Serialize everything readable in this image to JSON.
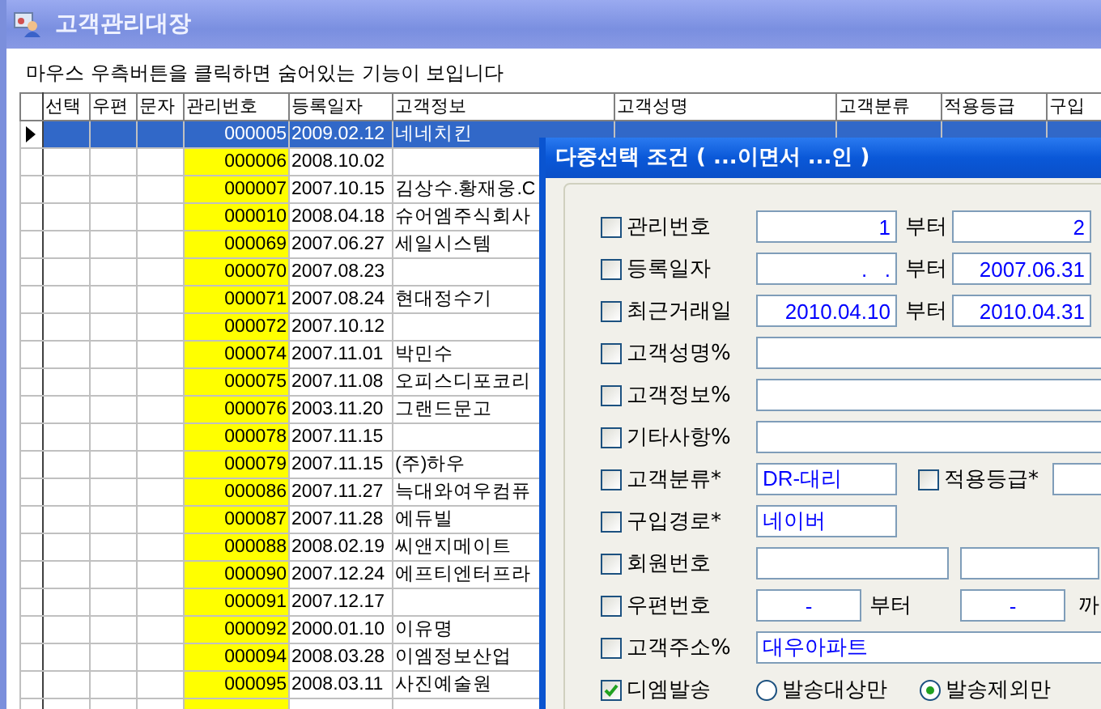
{
  "window": {
    "title": "고객관리대장"
  },
  "instruction": "마우스 우측버튼을 클릭하면 숨어있는 기능이 보입니다",
  "table": {
    "columns": [
      "선택",
      "우편",
      "문자",
      "관리번호",
      "등록일자",
      "고객정보",
      "고객성명",
      "고객분류",
      "적용등급",
      "구입"
    ],
    "rows": [
      {
        "selected": true,
        "id": "000005",
        "date": "2009.02.12",
        "info": "네네치킨"
      },
      {
        "selected": false,
        "id": "000006",
        "date": "2008.10.02"
      },
      {
        "selected": false,
        "id": "000007",
        "date": "2007.10.15",
        "info": "김상수.황재웅.C"
      },
      {
        "selected": false,
        "id": "000010",
        "date": "2008.04.18",
        "info": "슈어엠주식회사"
      },
      {
        "selected": false,
        "id": "000069",
        "date": "2007.06.27",
        "info": "세일시스템"
      },
      {
        "selected": false,
        "id": "000070",
        "date": "2007.08.23"
      },
      {
        "selected": false,
        "id": "000071",
        "date": "2007.08.24",
        "info": "현대정수기"
      },
      {
        "selected": false,
        "id": "000072",
        "date": "2007.10.12"
      },
      {
        "selected": false,
        "id": "000074",
        "date": "2007.11.01",
        "info": "박민수"
      },
      {
        "selected": false,
        "id": "000075",
        "date": "2007.11.08",
        "info": "오피스디포코리"
      },
      {
        "selected": false,
        "id": "000076",
        "date": "2003.11.20",
        "info": "그랜드문고"
      },
      {
        "selected": false,
        "id": "000078",
        "date": "2007.11.15"
      },
      {
        "selected": false,
        "id": "000079",
        "date": "2007.11.15",
        "info": "(주)하우"
      },
      {
        "selected": false,
        "id": "000086",
        "date": "2007.11.27",
        "info": "늑대와여우컴퓨"
      },
      {
        "selected": false,
        "id": "000087",
        "date": "2007.11.28",
        "info": "에듀빌"
      },
      {
        "selected": false,
        "id": "000088",
        "date": "2008.02.19",
        "info": "씨앤지메이트"
      },
      {
        "selected": false,
        "id": "000090",
        "date": "2007.12.24",
        "info": "에프티엔터프라"
      },
      {
        "selected": false,
        "id": "000091",
        "date": "2007.12.17"
      },
      {
        "selected": false,
        "id": "000092",
        "date": "2000.01.10",
        "info": "이유명"
      },
      {
        "selected": false,
        "id": "000094",
        "date": "2008.03.28",
        "info": "이엠정보산업"
      },
      {
        "selected": false,
        "id": "000095",
        "date": "2008.03.11",
        "info": "사진예술원"
      },
      {
        "selected": false
      }
    ]
  },
  "dialog": {
    "title": "다중선택 조건 ( ...이면서 ...인 )",
    "rows": [
      {
        "kind": "range",
        "checked": false,
        "label": "관리번호",
        "from": "1",
        "sep": "부터",
        "to": "2"
      },
      {
        "kind": "range",
        "checked": false,
        "label": "등록일자",
        "from": ".   .",
        "sep": "부터",
        "to": "2007.06.31"
      },
      {
        "kind": "range",
        "checked": false,
        "label": "최근거래일",
        "from": "2010.04.10",
        "sep": "부터",
        "to": "2010.04.31"
      },
      {
        "kind": "wide",
        "checked": false,
        "label": "고객성명%"
      },
      {
        "kind": "wide",
        "checked": false,
        "label": "고객정보%"
      },
      {
        "kind": "wide",
        "checked": false,
        "label": "기타사항%"
      },
      {
        "kind": "combo",
        "checked": false,
        "label": "고객분류*",
        "value": "DR-대리",
        "sub": {
          "checked": false,
          "label": "적용등급*"
        }
      },
      {
        "kind": "short",
        "checked": false,
        "label": "구입경로*",
        "value": "네이버"
      },
      {
        "kind": "double",
        "checked": false,
        "label": "회원번호"
      },
      {
        "kind": "postal",
        "checked": false,
        "label": "우편번호",
        "from": "-",
        "sep": "부터",
        "to": "-",
        "suffix": "까"
      },
      {
        "kind": "wide",
        "checked": false,
        "label": "고객주소%",
        "value": "대우아파트"
      },
      {
        "kind": "radio",
        "checked": true,
        "label": "디엠발송",
        "options": [
          {
            "label": "발송대상만",
            "selected": false
          },
          {
            "label": "발송제외만",
            "selected": true
          }
        ]
      }
    ]
  }
}
